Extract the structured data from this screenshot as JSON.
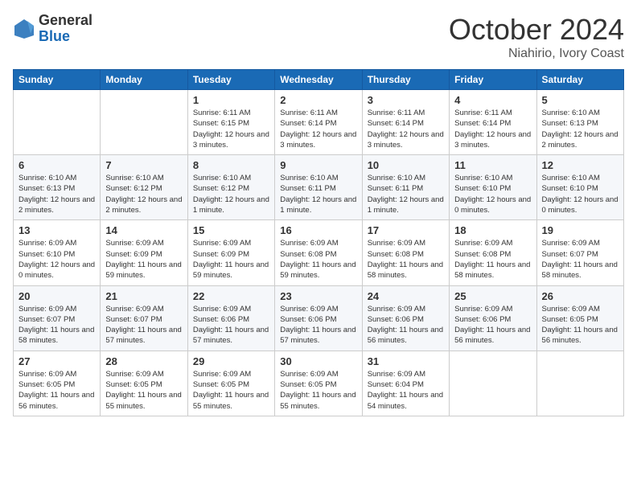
{
  "logo": {
    "general": "General",
    "blue": "Blue"
  },
  "title": {
    "month_year": "October 2024",
    "location": "Niahirio, Ivory Coast"
  },
  "days_of_week": [
    "Sunday",
    "Monday",
    "Tuesday",
    "Wednesday",
    "Thursday",
    "Friday",
    "Saturday"
  ],
  "weeks": [
    [
      {
        "day": "",
        "info": ""
      },
      {
        "day": "",
        "info": ""
      },
      {
        "day": "1",
        "info": "Sunrise: 6:11 AM\nSunset: 6:15 PM\nDaylight: 12 hours and 3 minutes."
      },
      {
        "day": "2",
        "info": "Sunrise: 6:11 AM\nSunset: 6:14 PM\nDaylight: 12 hours and 3 minutes."
      },
      {
        "day": "3",
        "info": "Sunrise: 6:11 AM\nSunset: 6:14 PM\nDaylight: 12 hours and 3 minutes."
      },
      {
        "day": "4",
        "info": "Sunrise: 6:11 AM\nSunset: 6:14 PM\nDaylight: 12 hours and 3 minutes."
      },
      {
        "day": "5",
        "info": "Sunrise: 6:10 AM\nSunset: 6:13 PM\nDaylight: 12 hours and 2 minutes."
      }
    ],
    [
      {
        "day": "6",
        "info": "Sunrise: 6:10 AM\nSunset: 6:13 PM\nDaylight: 12 hours and 2 minutes."
      },
      {
        "day": "7",
        "info": "Sunrise: 6:10 AM\nSunset: 6:12 PM\nDaylight: 12 hours and 2 minutes."
      },
      {
        "day": "8",
        "info": "Sunrise: 6:10 AM\nSunset: 6:12 PM\nDaylight: 12 hours and 1 minute."
      },
      {
        "day": "9",
        "info": "Sunrise: 6:10 AM\nSunset: 6:11 PM\nDaylight: 12 hours and 1 minute."
      },
      {
        "day": "10",
        "info": "Sunrise: 6:10 AM\nSunset: 6:11 PM\nDaylight: 12 hours and 1 minute."
      },
      {
        "day": "11",
        "info": "Sunrise: 6:10 AM\nSunset: 6:10 PM\nDaylight: 12 hours and 0 minutes."
      },
      {
        "day": "12",
        "info": "Sunrise: 6:10 AM\nSunset: 6:10 PM\nDaylight: 12 hours and 0 minutes."
      }
    ],
    [
      {
        "day": "13",
        "info": "Sunrise: 6:09 AM\nSunset: 6:10 PM\nDaylight: 12 hours and 0 minutes."
      },
      {
        "day": "14",
        "info": "Sunrise: 6:09 AM\nSunset: 6:09 PM\nDaylight: 11 hours and 59 minutes."
      },
      {
        "day": "15",
        "info": "Sunrise: 6:09 AM\nSunset: 6:09 PM\nDaylight: 11 hours and 59 minutes."
      },
      {
        "day": "16",
        "info": "Sunrise: 6:09 AM\nSunset: 6:08 PM\nDaylight: 11 hours and 59 minutes."
      },
      {
        "day": "17",
        "info": "Sunrise: 6:09 AM\nSunset: 6:08 PM\nDaylight: 11 hours and 58 minutes."
      },
      {
        "day": "18",
        "info": "Sunrise: 6:09 AM\nSunset: 6:08 PM\nDaylight: 11 hours and 58 minutes."
      },
      {
        "day": "19",
        "info": "Sunrise: 6:09 AM\nSunset: 6:07 PM\nDaylight: 11 hours and 58 minutes."
      }
    ],
    [
      {
        "day": "20",
        "info": "Sunrise: 6:09 AM\nSunset: 6:07 PM\nDaylight: 11 hours and 58 minutes."
      },
      {
        "day": "21",
        "info": "Sunrise: 6:09 AM\nSunset: 6:07 PM\nDaylight: 11 hours and 57 minutes."
      },
      {
        "day": "22",
        "info": "Sunrise: 6:09 AM\nSunset: 6:06 PM\nDaylight: 11 hours and 57 minutes."
      },
      {
        "day": "23",
        "info": "Sunrise: 6:09 AM\nSunset: 6:06 PM\nDaylight: 11 hours and 57 minutes."
      },
      {
        "day": "24",
        "info": "Sunrise: 6:09 AM\nSunset: 6:06 PM\nDaylight: 11 hours and 56 minutes."
      },
      {
        "day": "25",
        "info": "Sunrise: 6:09 AM\nSunset: 6:06 PM\nDaylight: 11 hours and 56 minutes."
      },
      {
        "day": "26",
        "info": "Sunrise: 6:09 AM\nSunset: 6:05 PM\nDaylight: 11 hours and 56 minutes."
      }
    ],
    [
      {
        "day": "27",
        "info": "Sunrise: 6:09 AM\nSunset: 6:05 PM\nDaylight: 11 hours and 56 minutes."
      },
      {
        "day": "28",
        "info": "Sunrise: 6:09 AM\nSunset: 6:05 PM\nDaylight: 11 hours and 55 minutes."
      },
      {
        "day": "29",
        "info": "Sunrise: 6:09 AM\nSunset: 6:05 PM\nDaylight: 11 hours and 55 minutes."
      },
      {
        "day": "30",
        "info": "Sunrise: 6:09 AM\nSunset: 6:05 PM\nDaylight: 11 hours and 55 minutes."
      },
      {
        "day": "31",
        "info": "Sunrise: 6:09 AM\nSunset: 6:04 PM\nDaylight: 11 hours and 54 minutes."
      },
      {
        "day": "",
        "info": ""
      },
      {
        "day": "",
        "info": ""
      }
    ]
  ]
}
